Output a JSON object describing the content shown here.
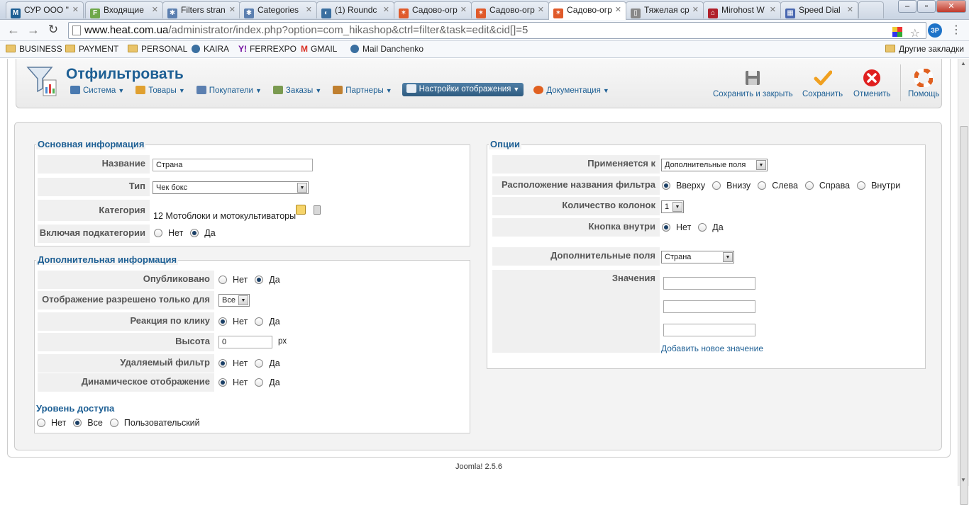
{
  "browser": {
    "tabs": [
      {
        "title": "СУР ООО \"",
        "favicon": "M",
        "color": "#1d5f94"
      },
      {
        "title": "Входящие",
        "favicon": "F",
        "color": "#6fa84a"
      },
      {
        "title": "Filters stran",
        "favicon": "✱",
        "color": "#5b7fb0"
      },
      {
        "title": "Categories",
        "favicon": "✱",
        "color": "#5b7fb0"
      },
      {
        "title": "(1) Roundc",
        "favicon": "◐",
        "color": "#3a6fa0"
      },
      {
        "title": "Садово-огр",
        "favicon": "✶",
        "color": "#e05a2a"
      },
      {
        "title": "Садово-огр",
        "favicon": "✶",
        "color": "#e05a2a"
      },
      {
        "title": "Садово-огр",
        "favicon": "✶",
        "color": "#e05a2a"
      },
      {
        "title": "Тяжелая ср",
        "favicon": "▯",
        "color": "#888"
      },
      {
        "title": "Mirohost W",
        "favicon": "⌂",
        "color": "#b0202a"
      },
      {
        "title": "Speed Dial",
        "favicon": "▦",
        "color": "#4a68b0"
      }
    ],
    "url_host": "www.heat.com.ua",
    "url_path": "/administrator/index.php?option=com_hikashop&ctrl=filter&task=edit&cid[]=5",
    "bookmarks": [
      "BUSINESS",
      "PAYMENT",
      "PERSONAL",
      "KAIRA",
      "FERREXPO",
      "GMAIL",
      "Mail Danchenko"
    ],
    "other_bookmarks": "Другие закладки"
  },
  "header": {
    "title": "Отфильтровать",
    "menu": [
      {
        "label": "Система",
        "color": "#4a7ab0"
      },
      {
        "label": "Товары",
        "color": "#e0a030"
      },
      {
        "label": "Покупатели",
        "color": "#5b7fb0"
      },
      {
        "label": "Заказы",
        "color": "#7a9a50"
      },
      {
        "label": "Партнеры",
        "color": "#c08030"
      },
      {
        "label": "Настройки отображения",
        "color": "#e8eef5"
      },
      {
        "label": "Документация",
        "color": "#e06020"
      }
    ],
    "actions": {
      "save_close": "Сохранить и закрыть",
      "save": "Сохранить",
      "cancel": "Отменить",
      "help": "Помощь"
    }
  },
  "basic": {
    "legend": "Основная информация",
    "name_label": "Название",
    "name_value": "Страна",
    "type_label": "Тип",
    "type_value": "Чек бокс",
    "category_label": "Категория",
    "category_value": "12 Мотоблоки и мотокультиваторы",
    "subcat_label": "Включая подкатегории",
    "no": "Нет",
    "yes": "Да"
  },
  "extra": {
    "legend": "Дополнительная информация",
    "published_label": "Опубликовано",
    "display_for_label": "Отображение разрешено только для",
    "display_for_value": "Все",
    "click_label": "Реакция по клику",
    "height_label": "Высота",
    "height_value": "0",
    "height_unit": "px",
    "deletable_label": "Удаляемый фильтр",
    "dynamic_label": "Динамическое отображение",
    "access_label": "Уровень доступа",
    "access_none": "Нет",
    "access_all": "Все",
    "access_custom": "Пользовательский"
  },
  "options": {
    "legend": "Опции",
    "applies_label": "Применяется к",
    "applies_value": "Дополнительные поля",
    "position_label": "Расположение названия фильтра",
    "pos_top": "Вверху",
    "pos_bottom": "Внизу",
    "pos_left": "Слева",
    "pos_right": "Справа",
    "pos_inside": "Внутри",
    "columns_label": "Количество колонок",
    "columns_value": "1",
    "button_label": "Кнопка внутри",
    "fields_label": "Дополнительные поля",
    "fields_value": "Страна",
    "values_label": "Значения",
    "add_value": "Добавить новое значение"
  },
  "footer": {
    "version": "Joomla! 2.5.6"
  }
}
